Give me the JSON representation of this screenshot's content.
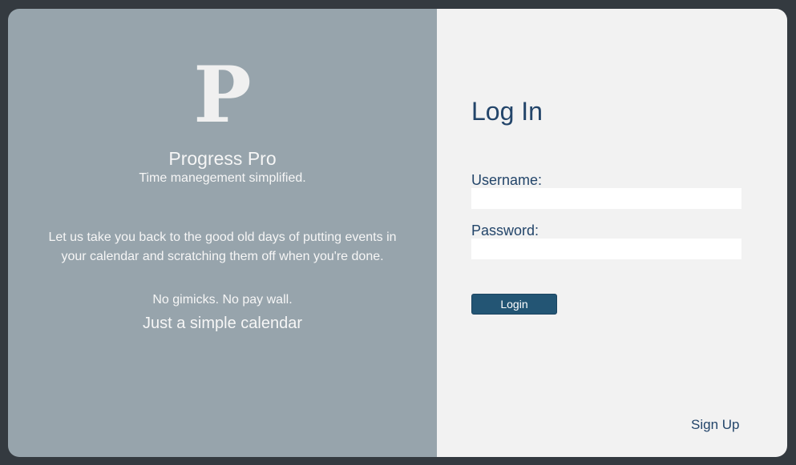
{
  "brand": {
    "logo_letter": "P",
    "name": "Progress Pro",
    "tagline": "Time manegement simplified."
  },
  "pitch": {
    "description": "Let us take you back to the good old days of putting events in your calendar and scratching them off when you're done.",
    "no_gimmicks": "No gimicks. No pay wall.",
    "simple": "Just a simple calendar"
  },
  "login": {
    "title": "Log In",
    "username_label": "Username:",
    "username_value": "",
    "password_label": "Password:",
    "password_value": "",
    "button_label": "Login",
    "signup_label": "Sign Up"
  },
  "colors": {
    "background": "#343a40",
    "left_panel": "#97a4ac",
    "right_panel": "#f2f2f2",
    "accent": "#23456a",
    "button": "#235574"
  }
}
